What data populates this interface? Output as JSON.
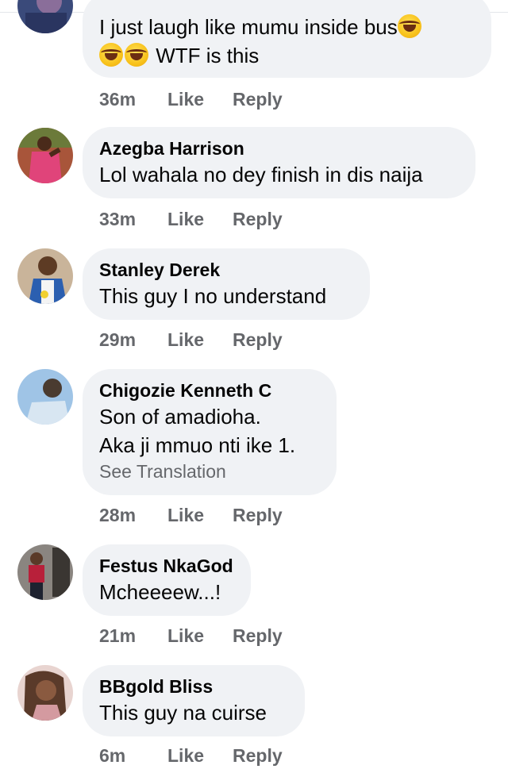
{
  "comments": [
    {
      "name": "",
      "lines": [
        "I just laugh like mumu inside bus",
        "WTF is this"
      ],
      "time": "36m",
      "like": "Like",
      "reply": "Reply",
      "avatar_colors": [
        "#3a4a7a",
        "#8a6e9a"
      ]
    },
    {
      "name": "Azegba Harrison",
      "lines": [
        "Lol wahala no dey finish in dis naija"
      ],
      "time": "33m",
      "like": "Like",
      "reply": "Reply",
      "avatar_colors": [
        "#a8553a",
        "#e0447a"
      ]
    },
    {
      "name": "Stanley Derek",
      "lines": [
        "This guy I no understand"
      ],
      "time": "29m",
      "like": "Like",
      "reply": "Reply",
      "avatar_colors": [
        "#5d3b24",
        "#2b5fb0"
      ]
    },
    {
      "name": "Chigozie Kenneth C",
      "lines": [
        "Son of amadioha.",
        "Aka ji mmuo nti ike 1."
      ],
      "see_translation": "See Translation",
      "time": "28m",
      "like": "Like",
      "reply": "Reply",
      "avatar_colors": [
        "#9fc4e6",
        "#4a3b30"
      ]
    },
    {
      "name": "Festus NkaGod",
      "lines": [
        "Mcheeeew...!"
      ],
      "time": "21m",
      "like": "Like",
      "reply": "Reply",
      "avatar_colors": [
        "#8a8580",
        "#b8203a"
      ]
    },
    {
      "name": "BBgold Bliss",
      "lines": [
        "This guy na cuirse"
      ],
      "time": "6m",
      "like": "Like",
      "reply": "Reply",
      "avatar_colors": [
        "#5a3a2a",
        "#d49aa0"
      ]
    }
  ],
  "icons": {
    "emoji": "rolling-on-floor-laughing-emoji"
  },
  "colors": {
    "bubble": "#f0f2f5",
    "meta_text": "#65676b",
    "name_text": "#050505"
  }
}
